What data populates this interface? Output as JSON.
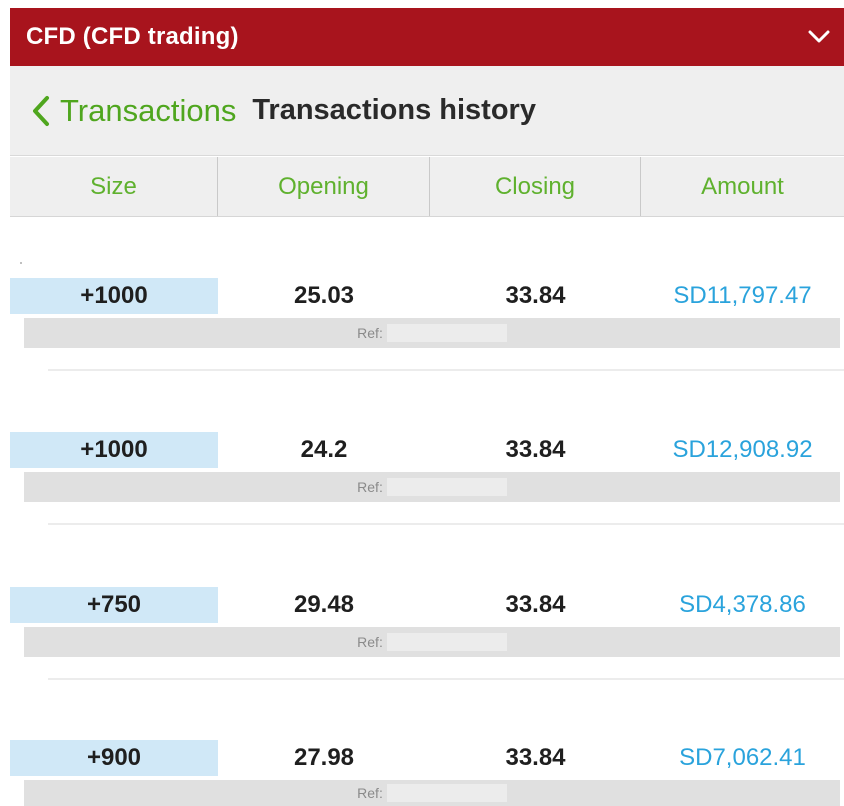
{
  "header": {
    "title": "CFD (CFD trading)"
  },
  "nav": {
    "back_label": "Transactions",
    "title": "Transactions history"
  },
  "columns": {
    "size": "Size",
    "opening": "Opening",
    "closing": "Closing",
    "amount": "Amount"
  },
  "ref_label": "Ref:",
  "rows": [
    {
      "size": "+1000",
      "opening": "25.03",
      "closing": "33.84",
      "amount": "SD11,797.47"
    },
    {
      "size": "+1000",
      "opening": "24.2",
      "closing": "33.84",
      "amount": "SD12,908.92"
    },
    {
      "size": "+750",
      "opening": "29.48",
      "closing": "33.84",
      "amount": "SD4,378.86"
    },
    {
      "size": "+900",
      "opening": "27.98",
      "closing": "33.84",
      "amount": "SD7,062.41"
    }
  ],
  "colors": {
    "header_red": "#a8141d",
    "accent_green": "#4fa61e",
    "amount_blue": "#2aa3dc",
    "size_bg": "#d0e8f7"
  },
  "icons": {
    "dropdown": "chevron-down-icon",
    "back": "chevron-left-icon"
  }
}
